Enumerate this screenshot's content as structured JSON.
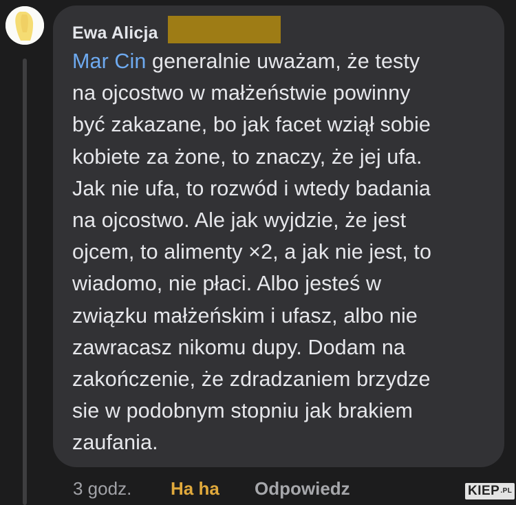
{
  "comment": {
    "author": "Ewa Alicja",
    "mention": "Mar Cin",
    "text_lines": [
      " generalnie uważam, że testy",
      "na ojcostwo w małżeństwie powinny",
      "być zakazane, bo jak facet wziął sobie",
      "kobiete za żone, to znaczy, że jej ufa.",
      "Jak nie ufa, to rozwód i wtedy badania",
      "na ojcostwo. Ale jak wyjdzie, że jest",
      "ojcem, to alimenty ×2, a jak nie jest, to",
      "wiadomo, nie płaci. Albo jesteś w",
      "związku małżeńskim i ufasz, albo nie",
      "zawracasz nikomu dupy. Dodam na",
      "zakończenie, że zdradzaniem brzydze",
      "sie w podobnym stopniu jak brakiem",
      "zaufania."
    ]
  },
  "actions": {
    "time": "3 godz.",
    "reaction": "Ha ha",
    "reply": "Odpowiedz"
  },
  "watermark": {
    "text": "KIEP",
    "suffix": ".PL"
  },
  "colors": {
    "background": "#1c1c1d",
    "bubble": "#323235",
    "mention": "#6eaaf0",
    "reaction": "#e0a93c",
    "redaction": "#9e7c15"
  }
}
